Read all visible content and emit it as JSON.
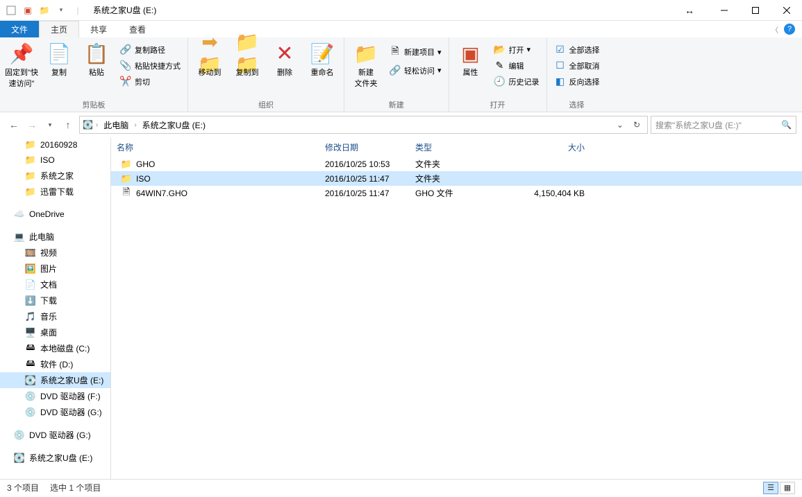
{
  "title": "系统之家U盘 (E:)",
  "tabs": {
    "file": "文件",
    "home": "主页",
    "share": "共享",
    "view": "查看"
  },
  "ribbon": {
    "clipboard": {
      "pin": "固定到\"快\n速访问\"",
      "copy": "复制",
      "paste": "粘贴",
      "copy_path": "复制路径",
      "paste_shortcut": "粘贴快捷方式",
      "cut": "剪切",
      "label": "剪贴板"
    },
    "organize": {
      "move_to": "移动到",
      "copy_to": "复制到",
      "delete": "删除",
      "rename": "重命名",
      "label": "组织"
    },
    "new": {
      "new_folder": "新建\n文件夹",
      "new_item": "新建项目",
      "easy_access": "轻松访问",
      "label": "新建"
    },
    "open": {
      "properties": "属性",
      "open": "打开",
      "edit": "编辑",
      "history": "历史记录",
      "label": "打开"
    },
    "select": {
      "select_all": "全部选择",
      "select_none": "全部取消",
      "invert": "反向选择",
      "label": "选择"
    }
  },
  "breadcrumb": {
    "this_pc": "此电脑",
    "current": "系统之家U盘 (E:)"
  },
  "search_placeholder": "搜索\"系统之家U盘 (E:)\"",
  "columns": {
    "name": "名称",
    "date": "修改日期",
    "type": "类型",
    "size": "大小"
  },
  "tree": [
    {
      "label": "20160928",
      "lvl": 1,
      "icon": "folder"
    },
    {
      "label": "ISO",
      "lvl": 1,
      "icon": "folder"
    },
    {
      "label": "系统之家",
      "lvl": 1,
      "icon": "folder"
    },
    {
      "label": "迅雷下载",
      "lvl": 1,
      "icon": "folder"
    },
    {
      "blank": true
    },
    {
      "label": "OneDrive",
      "lvl": 0,
      "icon": "cloud"
    },
    {
      "blank": true
    },
    {
      "label": "此电脑",
      "lvl": 0,
      "icon": "pc"
    },
    {
      "label": "视频",
      "lvl": 1,
      "icon": "video"
    },
    {
      "label": "图片",
      "lvl": 1,
      "icon": "pics"
    },
    {
      "label": "文档",
      "lvl": 1,
      "icon": "docs"
    },
    {
      "label": "下载",
      "lvl": 1,
      "icon": "down"
    },
    {
      "label": "音乐",
      "lvl": 1,
      "icon": "music"
    },
    {
      "label": "桌面",
      "lvl": 1,
      "icon": "desk"
    },
    {
      "label": "本地磁盘 (C:)",
      "lvl": 1,
      "icon": "drive"
    },
    {
      "label": "软件 (D:)",
      "lvl": 1,
      "icon": "drive"
    },
    {
      "label": "系统之家U盘 (E:)",
      "lvl": 1,
      "icon": "usb",
      "selected": true
    },
    {
      "label": "DVD 驱动器 (F:)",
      "lvl": 1,
      "icon": "disc"
    },
    {
      "label": "DVD 驱动器 (G:)",
      "lvl": 1,
      "icon": "disc"
    },
    {
      "blank": true
    },
    {
      "label": "DVD 驱动器 (G:)",
      "lvl": 0,
      "icon": "disc"
    },
    {
      "blank": true
    },
    {
      "label": "系统之家U盘 (E:)",
      "lvl": 0,
      "icon": "usb"
    }
  ],
  "files": [
    {
      "name": "GHO",
      "date": "2016/10/25 10:53",
      "type": "文件夹",
      "size": "",
      "icon": "folder"
    },
    {
      "name": "ISO",
      "date": "2016/10/25 11:47",
      "type": "文件夹",
      "size": "",
      "icon": "folder",
      "selected": true
    },
    {
      "name": "64WIN7.GHO",
      "date": "2016/10/25 11:47",
      "type": "GHO 文件",
      "size": "4,150,404 KB",
      "icon": "file"
    }
  ],
  "status": {
    "count": "3 个项目",
    "selected": "选中 1 个项目"
  }
}
